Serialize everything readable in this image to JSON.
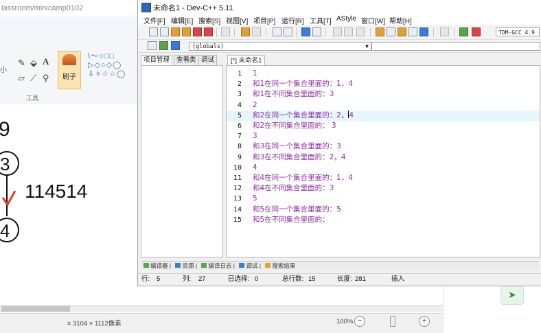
{
  "paint": {
    "url_text": "lassroom/minicamp0102",
    "tool_size_label": "小",
    "brush_label": "刷子",
    "tools_group_label": "工具",
    "shape_row1": "\\〜○□□",
    "shape_row2": "▷◇○◇◯",
    "shape_row3": "⇩✧☆☆◯",
    "drawing": {
      "top_number": "9",
      "node1": "3",
      "edge_label": "114514",
      "node2": "4"
    },
    "image_size": "3104 × 1112像素",
    "zoom": "100%",
    "zoom_minus": "−",
    "zoom_plus": "+"
  },
  "devcpp": {
    "title": "未命名1 - Dev-C++ 5.11",
    "menu": [
      "文件[F]",
      "编辑[E]",
      "搜索[S]",
      "视图[V]",
      "项目[P]",
      "运行[R]",
      "工具[T]",
      "AStyle",
      "窗口[W]",
      "帮助[H]"
    ],
    "compiler": "TDM-GCC 4.9",
    "scope": "(globals)",
    "left_tabs": [
      "项目管理",
      "查看类",
      "调试"
    ],
    "editor_tab": "[*] 未命名1",
    "code_lines": [
      {
        "n": "1",
        "text": "1"
      },
      {
        "n": "2",
        "text": "和1在同一个集合里面的：1，4"
      },
      {
        "n": "3",
        "text": "和1在不同集合里面的：3"
      },
      {
        "n": "4",
        "text": "2"
      },
      {
        "n": "5",
        "text": "和2在同一个集合里面的：2，",
        "after_caret": "4"
      },
      {
        "n": "6",
        "text": "和2在不同集合里面的：  3"
      },
      {
        "n": "7",
        "text": "3"
      },
      {
        "n": "8",
        "text": "和3在同一个集合里面的：3"
      },
      {
        "n": "9",
        "text": "和3在不同集合里面的：2，4"
      },
      {
        "n": "10",
        "text": "4"
      },
      {
        "n": "11",
        "text": "和4在同一个集合里面的：1，4"
      },
      {
        "n": "12",
        "text": "和4在不同集合里面的：3"
      },
      {
        "n": "13",
        "text": "5"
      },
      {
        "n": "14",
        "text": "和5在同一个集合里面的：5"
      },
      {
        "n": "15",
        "text": "和5在不同集合里面的："
      }
    ],
    "bottom_tabs": [
      "编译器",
      "资源",
      "编译日志",
      "调试",
      "搜索结果"
    ],
    "status": {
      "row_label": "行:",
      "row_value": "5",
      "col_label": "列:",
      "col_value": "27",
      "sel_label": "已选择:",
      "sel_value": "0",
      "total_label": "总行数:",
      "total_value": "15",
      "len_label": "长度:",
      "len_value": "281",
      "mode": "插入"
    }
  },
  "colors": {
    "code_text": "#8a2f9a",
    "current_line": "#e6f6ff",
    "red_mark": "#e23a2a"
  }
}
